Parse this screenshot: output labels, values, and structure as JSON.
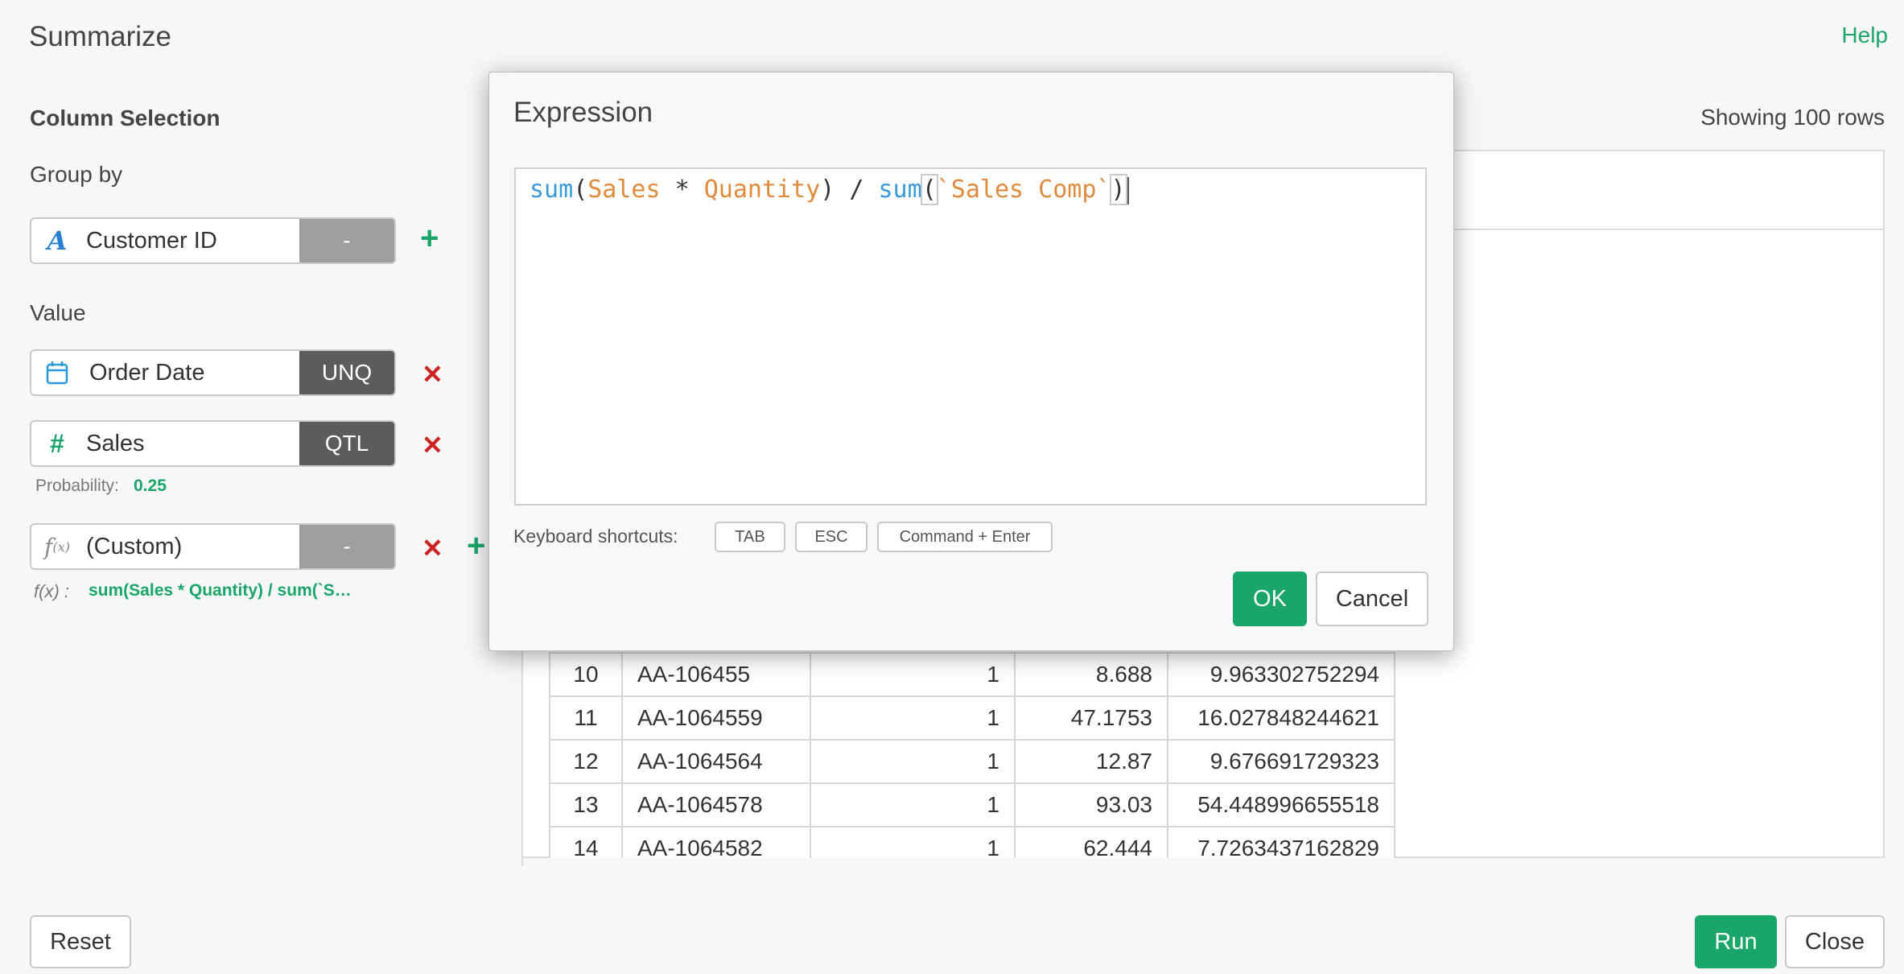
{
  "page": {
    "title": "Summarize",
    "help": "Help"
  },
  "left": {
    "column_selection": "Column Selection",
    "group_by_label": "Group by",
    "group_by": {
      "icon": "string-type-icon",
      "name": "Customer ID",
      "agg": "-"
    },
    "value_label": "Value",
    "values": [
      {
        "icon": "calendar-icon",
        "name": "Order Date",
        "agg": "UNQ"
      },
      {
        "icon": "number-hash-icon",
        "name": "Sales",
        "agg": "QTL"
      },
      {
        "icon": "function-icon",
        "name": "(Custom)",
        "agg": "-"
      }
    ],
    "probability_label": "Probability:",
    "probability_value": "0.25",
    "custom_expr_prefix": "f(x) :",
    "custom_expr": "sum(Sales * Quantity) / sum(`S…"
  },
  "preview": {
    "showing": "Showing 100 rows",
    "rows": [
      [
        "10",
        "AA-106455",
        "1",
        "8.688",
        "9.963302752294"
      ],
      [
        "11",
        "AA-1064559",
        "1",
        "47.1753",
        "16.027848244621"
      ],
      [
        "12",
        "AA-1064564",
        "1",
        "12.87",
        "9.676691729323"
      ],
      [
        "13",
        "AA-1064578",
        "1",
        "93.03",
        "54.448996655518"
      ],
      [
        "14",
        "AA-1064582",
        "1",
        "62.444",
        "7.7263437162829"
      ]
    ]
  },
  "modal": {
    "title": "Expression",
    "tokens": {
      "fn1": "sum",
      "p1": "(",
      "col1": "Sales",
      "op1": " * ",
      "col2": "Quantity",
      "p2": ")",
      "op2": " / ",
      "fn2": "sum",
      "p3": "(",
      "col3": "`Sales Comp`",
      "p4": ")"
    },
    "shortcuts_label": "Keyboard shortcuts:",
    "shortcuts": [
      "TAB",
      "ESC",
      "Command + Enter"
    ],
    "ok": "OK",
    "cancel": "Cancel"
  },
  "footer": {
    "reset": "Reset",
    "run": "Run",
    "close": "Close"
  },
  "colors": {
    "accent": "#1aa56a",
    "danger": "#cc2222",
    "function_token": "#3a9ad9",
    "column_token": "#e08a3c"
  }
}
